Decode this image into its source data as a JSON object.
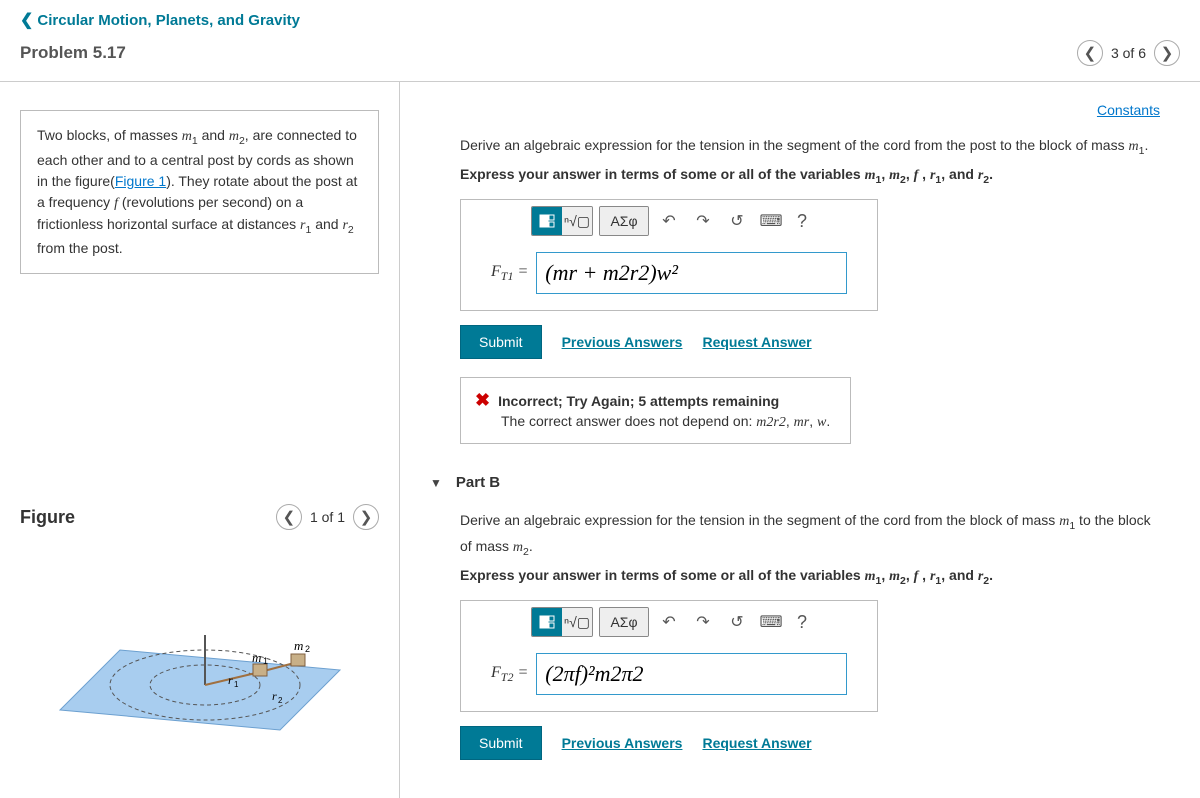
{
  "header": {
    "breadcrumb": "Circular Motion, Planets, and Gravity",
    "problem_title": "Problem 5.17",
    "pager_text": "3 of 6"
  },
  "left": {
    "problem_html": "Two blocks, of masses <span class='serif-i'>m</span><span class='sub'>1</span> and <span class='serif-i'>m</span><span class='sub'>2</span>, are connected to each other and to a central post by cords as shown in the figure(<a href='#'>Figure 1</a>). They rotate about the post at a frequency <span class='serif-i'>f</span> (revolutions per second) on a frictionless horizontal surface at distances <span class='serif-i'>r</span><span class='sub'>1</span> and <span class='serif-i'>r</span><span class='sub'>2</span> from the post.",
    "figure_label": "Figure",
    "figure_pager": "1 of 1"
  },
  "right": {
    "constants": "Constants",
    "partA": {
      "prompt_html": "Derive an algebraic expression for the tension in the segment of the cord from the post to the block of mass <span class='serif-i'>m</span><span class='sub'>1</span>.",
      "instr_html": "Express your answer in terms of some or all of the variables <span class='serif-i'>m</span><span class='sub'>1</span>, <span class='serif-i'>m</span><span class='sub'>2</span>, <span class='serif-i'>f</span> , <span class='serif-i'>r</span><span class='sub'>1</span>, and <span class='serif-i'>r</span><span class='sub'>2</span>.",
      "var_label_html": "<span class='serif-i'>F</span><span class='sub'>T1</span> = ",
      "input_value": "(mr + m2r2)w²",
      "submit": "Submit",
      "prev_answers": "Previous Answers",
      "request_answer": "Request Answer",
      "feedback_title": "Incorrect; Try Again; 5 attempts remaining",
      "feedback_body_html": "The correct answer does not depend on: <span class='serif-i'>m2r2</span>, <span class='serif-i'>mr</span>, <span class='serif-i'>w</span>."
    },
    "partB": {
      "title": "Part B",
      "prompt_html": "Derive an algebraic expression for the tension in the segment of the cord from the block of mass <span class='serif-i'>m</span><span class='sub'>1</span> to the block of mass <span class='serif-i'>m</span><span class='sub'>2</span>.",
      "instr_html": "Express your answer in terms of some or all of the variables <span class='serif-i'>m</span><span class='sub'>1</span>, <span class='serif-i'>m</span><span class='sub'>2</span>, <span class='serif-i'>f</span> , <span class='serif-i'>r</span><span class='sub'>1</span>, and <span class='serif-i'>r</span><span class='sub'>2</span>.",
      "var_label_html": "<span class='serif-i'>F</span><span class='sub'>T2</span> = ",
      "input_value": "(2πf)²m2π2",
      "submit": "Submit",
      "prev_answers": "Previous Answers",
      "request_answer": "Request Answer"
    },
    "toolbar": {
      "templates": "⬛",
      "sqrt": "ⁿ√▢",
      "greek": "ΑΣφ",
      "undo": "↶",
      "redo": "↷",
      "reset": "↺",
      "keyboard": "⌨",
      "help": "?"
    }
  }
}
